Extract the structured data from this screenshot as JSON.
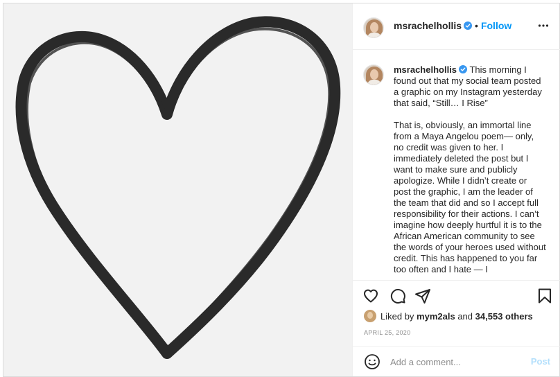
{
  "header": {
    "username": "msrachelhollis",
    "separator": "•",
    "follow_label": "Follow",
    "more_icon": "more-options-icon"
  },
  "caption": {
    "username": "msrachelhollis",
    "paragraph1": "This morning I found out that my social team posted a graphic on my Instagram yesterday that said, “Still… I Rise”",
    "paragraph2": "That is, obviously, an immortal line from a Maya Angelou poem— only, no credit was given to her. I immediately deleted the post but I want to make sure and publicly apologize. While I didn’t create or post the graphic, I am the leader of the team that did and so I accept full responsibility for their actions. I can’t imagine how deeply hurtful it is to the African American community to see the words of your heroes used without credit. This has happened to you far too often and I hate — I"
  },
  "likes": {
    "prefix": "Liked by",
    "user": "mym2als",
    "conjunction": "and",
    "others": "34,553 others"
  },
  "date": "APRIL 25, 2020",
  "comment": {
    "placeholder": "Add a comment...",
    "post_label": "Post"
  },
  "colors": {
    "link": "#0095f6",
    "verified": "#3897f0",
    "post_disabled": "#b2dffc",
    "heart_stroke": "#2a2a2a",
    "image_bg": "#f2f2f2"
  }
}
